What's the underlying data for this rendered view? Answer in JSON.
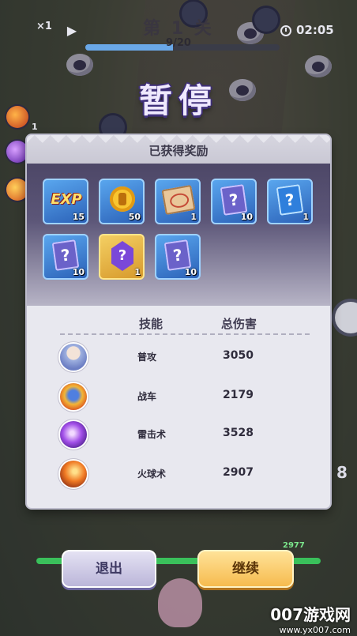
{
  "hud": {
    "speed_label": "×1",
    "level_title": "第 1 关",
    "wave_progress_text": "9/20",
    "wave_progress": 0.45,
    "timer": "02:05"
  },
  "side": {
    "left_skill_counts": [
      "1",
      "1"
    ],
    "right_number": "8"
  },
  "pause_title": "暂停",
  "modal": {
    "title": "已获得奖励",
    "rewards": [
      {
        "icon": "exp-icon",
        "qty": "15",
        "frame": "blue"
      },
      {
        "icon": "coin-icon",
        "qty": "50",
        "frame": "blue"
      },
      {
        "icon": "scroll-icon",
        "qty": "1",
        "frame": "blue"
      },
      {
        "icon": "mystery-card-icon",
        "qty": "10",
        "frame": "blue"
      },
      {
        "icon": "mystery-card-blue-icon",
        "qty": "1",
        "frame": "blue"
      },
      {
        "icon": "mystery-card-icon",
        "qty": "10",
        "frame": "blue"
      },
      {
        "icon": "mystery-crystal-icon",
        "qty": "1",
        "frame": "gold"
      },
      {
        "icon": "mystery-card-icon",
        "qty": "10",
        "frame": "blue"
      }
    ],
    "table": {
      "headers": {
        "skill": "技能",
        "damage": "总伤害"
      },
      "rows": [
        {
          "skill": "普攻",
          "damage": "3050",
          "avatar": "hero-avatar-icon"
        },
        {
          "skill": "战车",
          "damage": "2179",
          "avatar": "chariot-icon"
        },
        {
          "skill": "雷击术",
          "damage": "3528",
          "avatar": "thunder-strike-icon"
        },
        {
          "skill": "火球术",
          "damage": "2907",
          "avatar": "fireball-icon"
        }
      ]
    }
  },
  "bottom": {
    "hp_text": "2977",
    "hp_fraction": 1.0,
    "exit_label": "退出",
    "continue_label": "继续"
  },
  "watermark": {
    "main": "007游戏网",
    "sub": "www.yx007.com"
  },
  "colors": {
    "reward_frame_blue": "#2c62b8",
    "reward_frame_gold": "#d79a2c",
    "continue_button": "#f6b94b",
    "exit_button": "#b9b4d8",
    "hp_bar": "#3ac05b"
  }
}
